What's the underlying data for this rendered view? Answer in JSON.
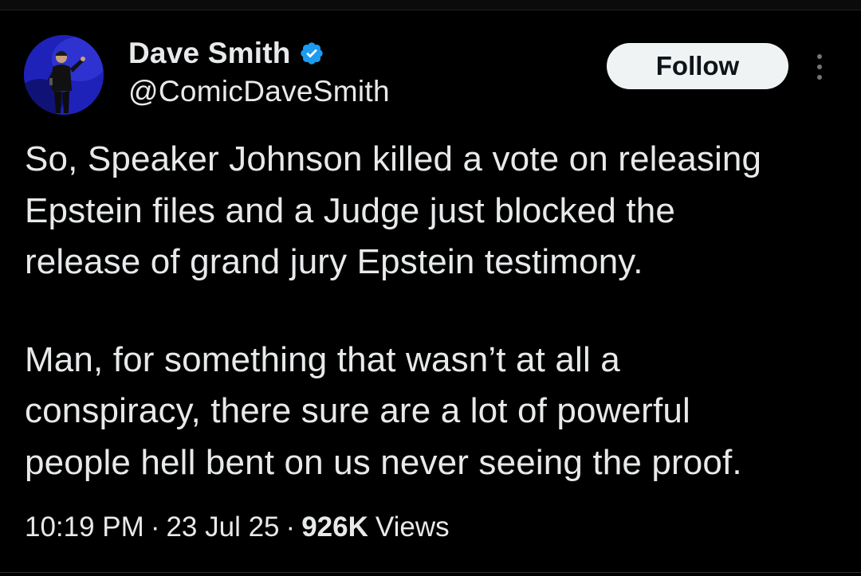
{
  "tweet": {
    "author": {
      "display_name": "Dave Smith",
      "handle": "@ComicDaveSmith",
      "verified": true,
      "avatar_icon": "profile-photo-comedian-on-stage"
    },
    "follow_label": "Follow",
    "more_icon": "more-vertical-icon",
    "paragraphs": [
      "So, Speaker Johnson killed a vote on releasing\nEpstein files and a Judge just blocked the\nrelease of grand jury Epstein testimony.",
      "Man, for something that wasn’t at all a\nconspiracy, there sure are a lot of powerful\npeople hell bent on us never seeing the proof."
    ],
    "meta": {
      "time": "10:19 PM",
      "separator": "·",
      "date": "23 Jul 25",
      "views_count": "926K",
      "views_label": "Views"
    }
  },
  "colors": {
    "background": "#000000",
    "text": "#e7e9ea",
    "verified_badge": "#1d9bf0",
    "follow_button_bg": "#eff3f4",
    "follow_button_text": "#0f1419"
  }
}
